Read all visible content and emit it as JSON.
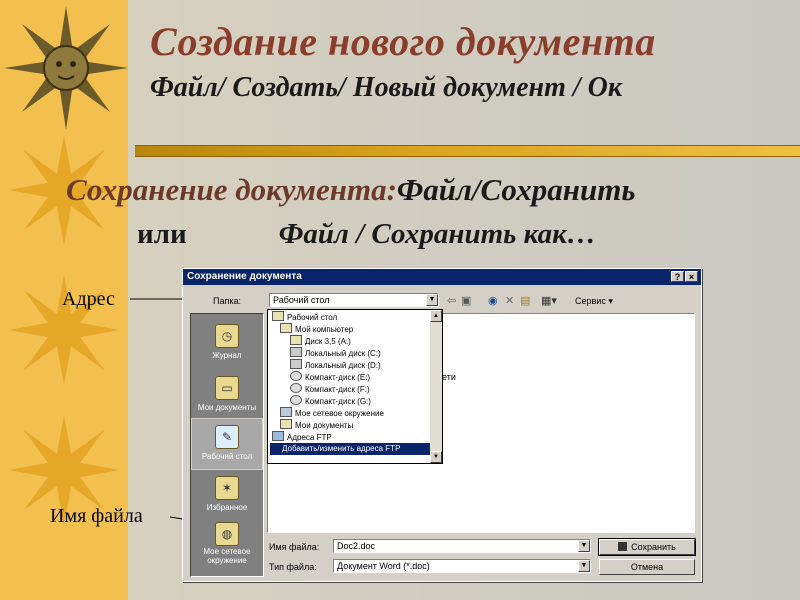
{
  "slide": {
    "title": "Создание нового документа",
    "subtitle": "Файл/ Создать/ Новый документ / Ок",
    "save_heading": "Сохранение документа:",
    "save_cmd1": "Файл/Сохранить",
    "or_label": "или",
    "save_cmd2": "Файл / Сохранить как…",
    "callout_address": "Адрес",
    "callout_filename": "Имя файла"
  },
  "dialog": {
    "title": "Сохранение документа",
    "help_btn": "?",
    "close_btn": "×",
    "folder_label": "Папка:",
    "folder_value": "Рабочий стол",
    "service_label": "Сервис",
    "places": [
      "Журнал",
      "Мои документы",
      "Рабочий стол",
      "Избранное",
      "Мое сетевое окружение"
    ],
    "dropdown_items": [
      "Рабочий стол",
      "Мой компьютер",
      "Диск 3,5 (A:)",
      "Локальный диск (C:)",
      "Локальный диск (D:)",
      "Компакт-диск (E:)",
      "Компакт-диск (F:)",
      "Компакт-диск (G:)",
      "Мое сетевое окружение",
      "Мои документы",
      "Адреса FTP",
      "Добавить/изменить адреса FTP"
    ],
    "partial_text": "ети",
    "filename_label": "Имя файла:",
    "filename_value": "Doc2.doc",
    "filetype_label": "Тип файла:",
    "filetype_value": "Документ Word (*.doc)",
    "save_button": "Сохранить",
    "cancel_button": "Отмена"
  },
  "colors": {
    "title": "#8a3d2a",
    "strip": "#f3c04f",
    "titlebar": "#0a246a"
  }
}
